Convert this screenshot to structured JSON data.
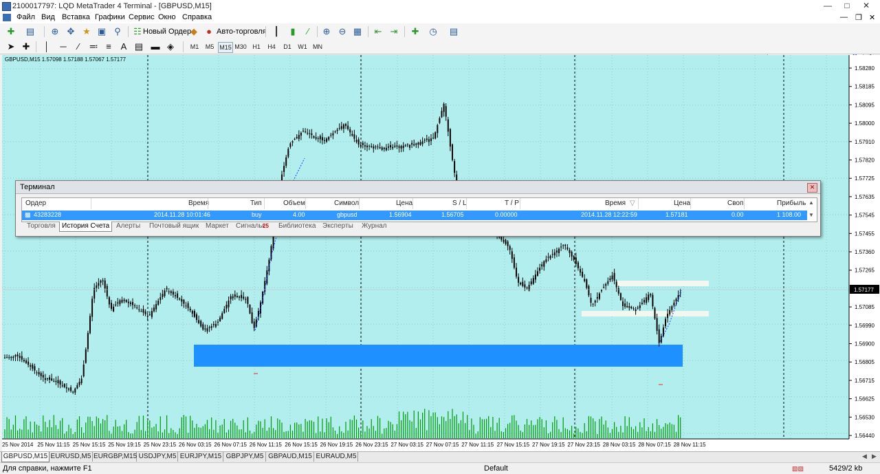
{
  "window": {
    "title": "2100017797: LQD MetaTrader 4 Terminal - [GBPUSD,M15]"
  },
  "menu": [
    "Файл",
    "Вид",
    "Вставка",
    "Графики",
    "Сервис",
    "Окно",
    "Справка"
  ],
  "toolbar": {
    "new_order": "Новый Ордер",
    "auto_trading": "Авто-торговля"
  },
  "timeframes": [
    "M1",
    "M5",
    "M15",
    "M30",
    "H1",
    "H4",
    "D1",
    "W1",
    "MN"
  ],
  "chart": {
    "header": "GBPUSD,M15  1.57098 1.57188 1.57067 1.57177",
    "price_ticks": [
      "1.58280",
      "1.58185",
      "1.58095",
      "1.58000",
      "1.57910",
      "1.57820",
      "1.57725",
      "1.57635",
      "1.57545",
      "1.57455",
      "1.57360",
      "1.57265",
      "1.57177",
      "1.57085",
      "1.56990",
      "1.56900",
      "1.56805",
      "1.56715",
      "1.56625",
      "1.56530",
      "1.56440"
    ],
    "current_price": "1.57177",
    "time_ticks": [
      "25 Nov 2014",
      "25 Nov 11:15",
      "25 Nov 15:15",
      "25 Nov 19:15",
      "25 Nov 23:15",
      "26 Nov 03:15",
      "26 Nov 07:15",
      "26 Nov 11:15",
      "26 Nov 15:15",
      "26 Nov 19:15",
      "26 Nov 23:15",
      "27 Nov 03:15",
      "27 Nov 07:15",
      "27 Nov 11:15",
      "27 Nov 15:15",
      "27 Nov 19:15",
      "27 Nov 23:15",
      "28 Nov 03:15",
      "28 Nov 07:15",
      "28 Nov 11:15"
    ],
    "colors": {
      "background": "#b2eeee",
      "candles": "#000000",
      "volume": "#009900",
      "zone": "#1e90ff",
      "levels": "#f2f8f0"
    }
  },
  "terminal": {
    "title": "Терминал",
    "columns": [
      "Ордер",
      "Время",
      "Тип",
      "Объем",
      "Символ",
      "Цена",
      "S / L",
      "T / P",
      "Время",
      "Цена",
      "Своп",
      "Прибыль"
    ],
    "row": [
      "43283228",
      "2014.11.28 10:01:46",
      "buy",
      "4.00",
      "gbpusd",
      "1.56904",
      "1.56705",
      "0.00000",
      "2014.11.28 12:22:59",
      "1.57181",
      "0.00",
      "1 108.00"
    ],
    "tabs": [
      "Торговля",
      "История Счета",
      "Алерты",
      "Почтовый ящик",
      "Маркет",
      "Сигналы",
      "Библиотека",
      "Эксперты",
      "Журнал"
    ],
    "signals_badge": "25"
  },
  "chart_tabs": [
    "GBPUSD,M15",
    "EURUSD,M5",
    "EURGBP,M15",
    "USDJPY,M5",
    "EURJPY,M15",
    "GBPJPY,M5",
    "GBPAUD,M15",
    "EURAUD,M5"
  ],
  "status": {
    "help": "Для справки, нажмите F1",
    "profile": "Default",
    "traffic": "5429/2 kb"
  }
}
